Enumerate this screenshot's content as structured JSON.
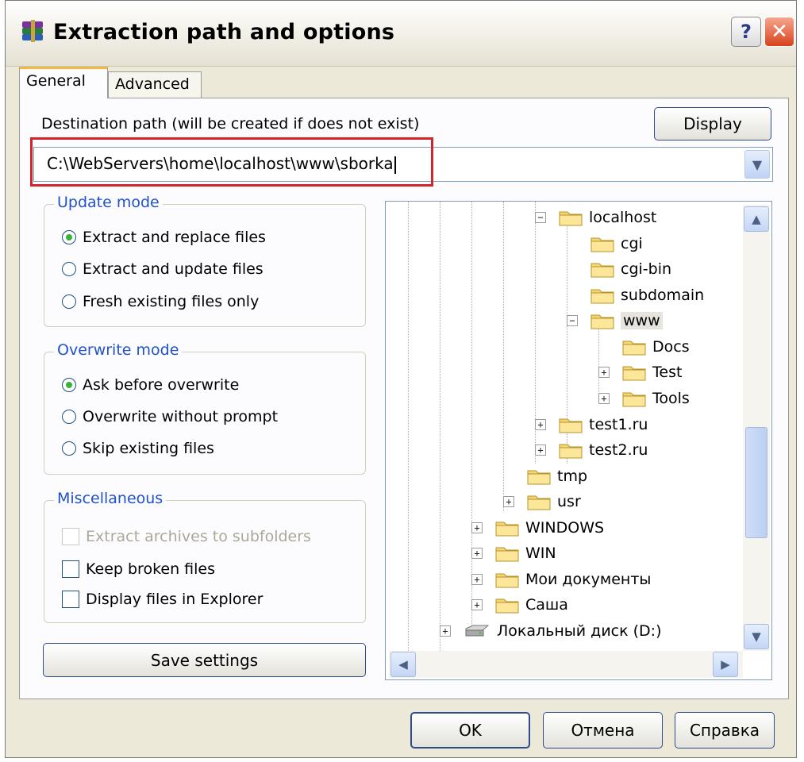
{
  "window": {
    "title": "Extraction path and options",
    "help_button": "?",
    "close_button": "✕"
  },
  "tabs": [
    {
      "label": "General"
    },
    {
      "label": "Advanced"
    }
  ],
  "destination": {
    "label": "Destination path (will be created if does not exist)",
    "value": "C:\\WebServers\\home\\localhost\\www\\sborka",
    "display_button": "Display",
    "dropdown_arrow": "▼"
  },
  "update_mode": {
    "title": "Update mode",
    "options": [
      "Extract and replace files",
      "Extract and update files",
      "Fresh existing files only"
    ],
    "selected_index": 0
  },
  "overwrite_mode": {
    "title": "Overwrite mode",
    "options": [
      "Ask before overwrite",
      "Overwrite without prompt",
      "Skip existing files"
    ],
    "selected_index": 0
  },
  "misc": {
    "title": "Miscellaneous",
    "options": [
      {
        "label": "Extract archives to subfolders",
        "checked": false,
        "enabled": false
      },
      {
        "label": "Keep broken files",
        "checked": false,
        "enabled": true
      },
      {
        "label": "Display files in Explorer",
        "checked": false,
        "enabled": true
      }
    ]
  },
  "save_settings": "Save settings",
  "tree": {
    "items": [
      {
        "label": "localhost",
        "expander": "−"
      },
      {
        "label": "cgi",
        "expander": ""
      },
      {
        "label": "cgi-bin",
        "expander": ""
      },
      {
        "label": "subdomain",
        "expander": ""
      },
      {
        "label": "www",
        "expander": "−",
        "selected": true
      },
      {
        "label": "Docs",
        "expander": ""
      },
      {
        "label": "Test",
        "expander": "+"
      },
      {
        "label": "Tools",
        "expander": "+"
      },
      {
        "label": "test1.ru",
        "expander": "+"
      },
      {
        "label": "test2.ru",
        "expander": "+"
      },
      {
        "label": "tmp",
        "expander": ""
      },
      {
        "label": "usr",
        "expander": "+"
      },
      {
        "label": "WINDOWS",
        "expander": "+"
      },
      {
        "label": "WIN",
        "expander": "+"
      },
      {
        "label": "Мои документы",
        "expander": "+"
      },
      {
        "label": "Саша",
        "expander": "+"
      },
      {
        "label": "Локальный диск (D:)",
        "expander": "+",
        "icon": "drive-icon"
      }
    ],
    "scroll_up": "▲",
    "scroll_down": "▼",
    "scroll_left": "◀",
    "scroll_right": "▶"
  },
  "buttons": {
    "ok": "OK",
    "cancel": "Отмена",
    "help": "Справка"
  },
  "colors": {
    "group_title": "#2152c9",
    "highlight": "#d0262b",
    "dialog_bg": "#ece9d8"
  }
}
